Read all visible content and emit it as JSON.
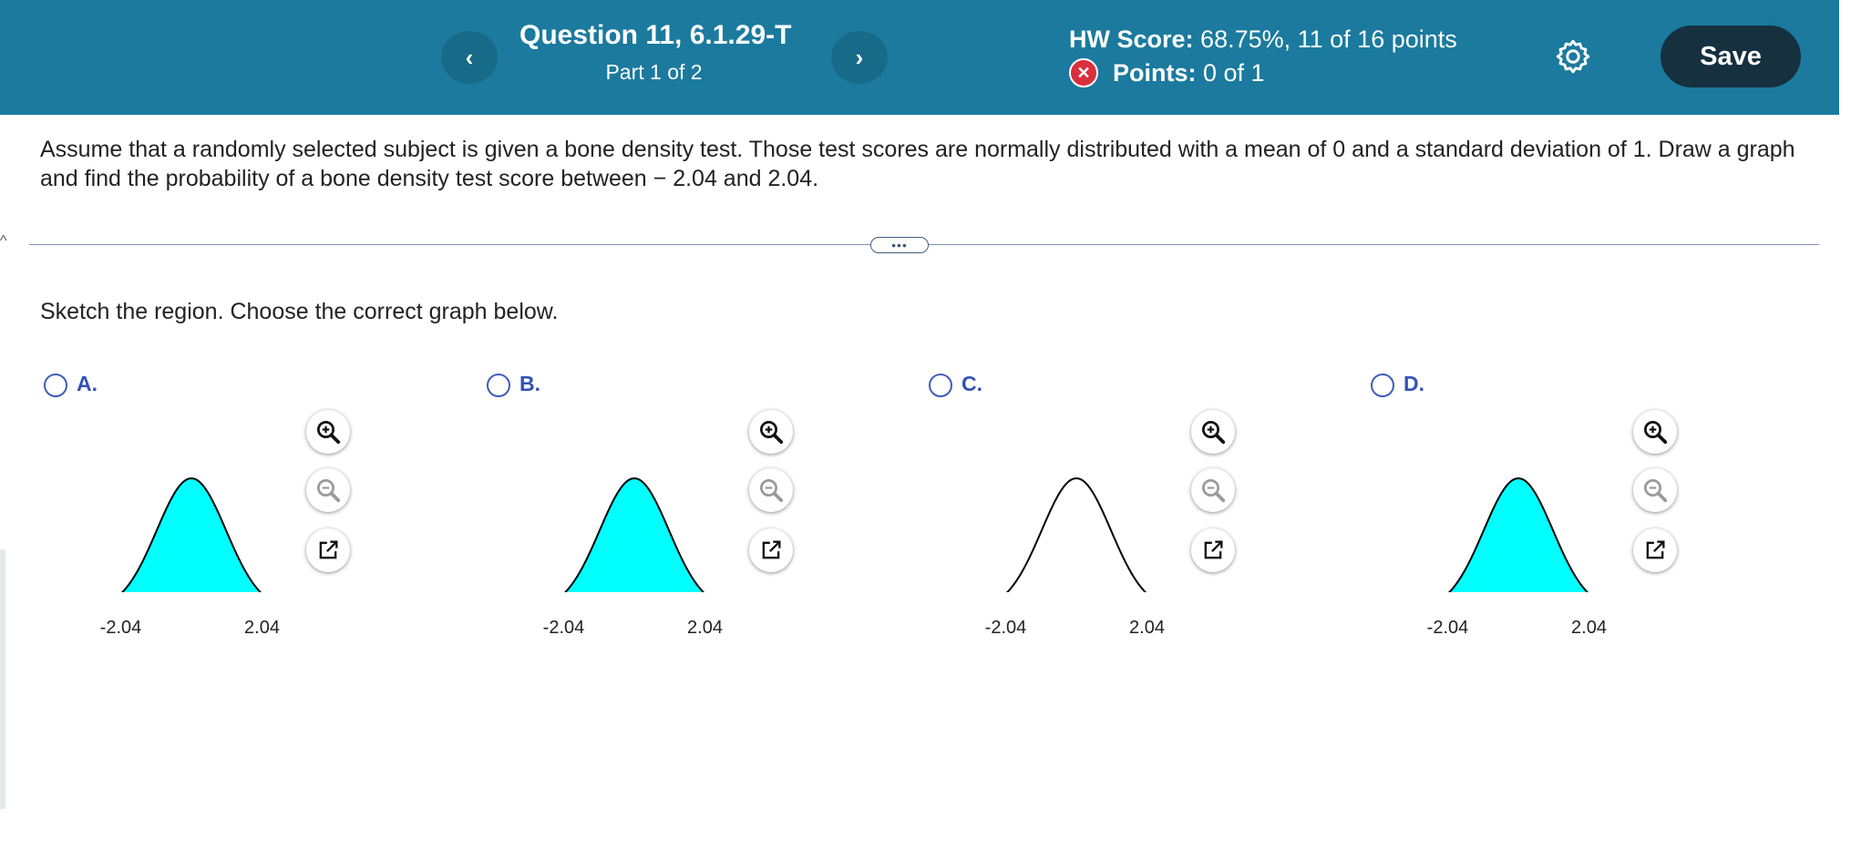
{
  "header": {
    "prev_label": "‹",
    "next_label": "›",
    "question_title": "Question 11, 6.1.29-T",
    "part": "Part 1 of 2",
    "hw_score_label": "HW Score:",
    "hw_score_value": "68.75%, 11 of 16 points",
    "points_label": "Points:",
    "points_value": "0 of 1",
    "save_label": "Save",
    "colors": {
      "bar": "#1b7a9e",
      "save": "#163040",
      "wrong": "#d9303e"
    }
  },
  "question": {
    "text": "Assume that a randomly selected subject is given a bone density test. Those test scores are normally distributed with a mean of 0 and a standard deviation of 1. Draw a graph and find the probability of a bone density test score between − 2.04 and 2.04.",
    "more_label": "•••",
    "prompt": "Sketch the region. Choose the correct graph below."
  },
  "options": [
    {
      "letter": "A.",
      "left_tick": "-2.04",
      "right_tick": "2.04",
      "shading": "between"
    },
    {
      "letter": "B.",
      "left_tick": "-2.04",
      "right_tick": "2.04",
      "shading": "between"
    },
    {
      "letter": "C.",
      "left_tick": "-2.04",
      "right_tick": "2.04",
      "shading": "tails"
    },
    {
      "letter": "D.",
      "left_tick": "-2.04",
      "right_tick": "2.04",
      "shading": "between"
    }
  ],
  "icons": {
    "zoom_in": "zoom-in-icon",
    "zoom_out": "zoom-out-icon",
    "popout": "popout-icon",
    "settings": "gear-icon"
  },
  "fill_color": "#00ffff"
}
